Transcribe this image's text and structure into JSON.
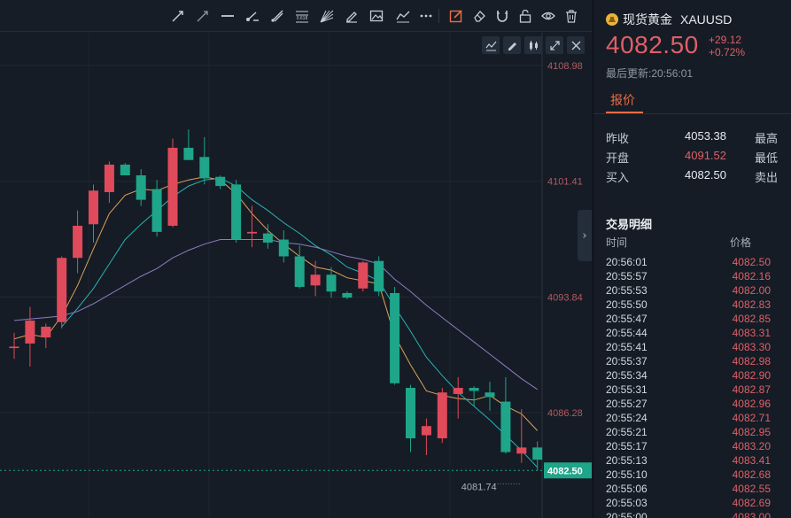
{
  "toolbar": {
    "tools": [
      "trend-line-icon",
      "ray-icon",
      "horizontal-line-icon",
      "info-line-icon",
      "parallel-channel-icon",
      "fib-retracement-icon",
      "fib-fan-icon",
      "brush-icon",
      "picture-icon",
      "path-icon",
      "more-icon",
      "edit-icon",
      "eraser-icon",
      "magnet-icon",
      "lock-icon",
      "eye-icon",
      "trash-icon"
    ],
    "fib_tool_text": "0.618",
    "active_color": "#ea6d47"
  },
  "chart_tools": [
    "indicator-icon",
    "draw-icon",
    "candle-type-icon",
    "fullscreen-icon",
    "close-icon"
  ],
  "chart_data": {
    "type": "candlestick",
    "symbol": "XAUUSD",
    "price_axis": {
      "ticks": [
        "4108.98",
        "4101.41",
        "4093.84",
        "4086.28"
      ],
      "tick_values": [
        4108.98,
        4101.41,
        4093.84,
        4086.28
      ],
      "range": [
        4079.0,
        4110.0
      ]
    },
    "last_price_label": "4082.50",
    "last_price": 4082.5,
    "low_label": "4081.74",
    "low_value": 4081.74,
    "up_color": "#e04a5a",
    "down_color": "#1fa589",
    "candles": [
      {
        "o": 4090.5,
        "h": 4091.5,
        "l": 4089.8,
        "c": 4090.6
      },
      {
        "o": 4090.8,
        "h": 4093.2,
        "l": 4089.3,
        "c": 4092.3
      },
      {
        "o": 4091.2,
        "h": 4092.1,
        "l": 4090.5,
        "c": 4091.9
      },
      {
        "o": 4092.2,
        "h": 4096.5,
        "l": 4091.8,
        "c": 4096.4
      },
      {
        "o": 4096.4,
        "h": 4099.5,
        "l": 4095.4,
        "c": 4098.5
      },
      {
        "o": 4098.6,
        "h": 4101.2,
        "l": 4097.4,
        "c": 4100.8
      },
      {
        "o": 4100.7,
        "h": 4102.7,
        "l": 4100.0,
        "c": 4102.5
      },
      {
        "o": 4102.5,
        "h": 4102.6,
        "l": 4101.8,
        "c": 4101.8
      },
      {
        "o": 4101.8,
        "h": 4102.2,
        "l": 4099.8,
        "c": 4100.2
      },
      {
        "o": 4100.9,
        "h": 4101.5,
        "l": 4097.8,
        "c": 4098.1
      },
      {
        "o": 4098.5,
        "h": 4104.2,
        "l": 4098.4,
        "c": 4103.6
      },
      {
        "o": 4103.6,
        "h": 4104.8,
        "l": 4102.8,
        "c": 4102.8
      },
      {
        "o": 4103.0,
        "h": 4104.3,
        "l": 4101.2,
        "c": 4101.6
      },
      {
        "o": 4101.7,
        "h": 4101.8,
        "l": 4100.9,
        "c": 4101.1
      },
      {
        "o": 4101.2,
        "h": 4101.5,
        "l": 4097.4,
        "c": 4097.6
      },
      {
        "o": 4098.0,
        "h": 4099.8,
        "l": 4097.1,
        "c": 4098.1
      },
      {
        "o": 4098.0,
        "h": 4098.6,
        "l": 4097.0,
        "c": 4097.4
      },
      {
        "o": 4097.6,
        "h": 4098.2,
        "l": 4096.1,
        "c": 4096.5
      },
      {
        "o": 4096.5,
        "h": 4097.2,
        "l": 4094.4,
        "c": 4094.5
      },
      {
        "o": 4094.6,
        "h": 4096.2,
        "l": 4093.9,
        "c": 4095.3
      },
      {
        "o": 4095.3,
        "h": 4095.8,
        "l": 4093.8,
        "c": 4094.2
      },
      {
        "o": 4094.1,
        "h": 4094.2,
        "l": 4093.7,
        "c": 4093.8
      },
      {
        "o": 4094.4,
        "h": 4096.2,
        "l": 4094.2,
        "c": 4096.1
      },
      {
        "o": 4096.2,
        "h": 4096.5,
        "l": 4093.9,
        "c": 4094.2
      },
      {
        "o": 4094.1,
        "h": 4094.5,
        "l": 4088.1,
        "c": 4088.2
      },
      {
        "o": 4087.9,
        "h": 4088.1,
        "l": 4083.7,
        "c": 4084.6
      },
      {
        "o": 4084.8,
        "h": 4085.9,
        "l": 4083.5,
        "c": 4085.4
      },
      {
        "o": 4084.6,
        "h": 4087.9,
        "l": 4084.3,
        "c": 4087.6
      },
      {
        "o": 4087.5,
        "h": 4088.6,
        "l": 4085.9,
        "c": 4087.9
      },
      {
        "o": 4087.9,
        "h": 4088.0,
        "l": 4086.7,
        "c": 4087.7
      },
      {
        "o": 4087.6,
        "h": 4088.3,
        "l": 4086.4,
        "c": 4087.3
      },
      {
        "o": 4087.0,
        "h": 4088.6,
        "l": 4083.6,
        "c": 4083.7
      },
      {
        "o": 4083.6,
        "h": 4086.5,
        "l": 4083.0,
        "c": 4084.0
      },
      {
        "o": 4084.0,
        "h": 4084.4,
        "l": 4082.5,
        "c": 4083.2
      }
    ],
    "ma_lines": [
      {
        "color": "#e0a156",
        "values": [
          4091.1,
          4091.4,
          4091.2,
          4092.6,
          4094.6,
          4097.0,
          4099.3,
          4100.5,
          4100.9,
          4100.8,
          4101.2,
          4101.5,
          4101.7,
          4101.5,
          4100.6,
          4099.3,
          4098.2,
          4097.3,
          4096.5,
          4095.8,
          4095.6,
          4095.1,
          4094.9,
          4094.7,
          4091.3,
          4089.4,
          4087.7,
          4087.4,
          4087.2,
          4087.1,
          4087.4,
          4086.7,
          4086.2,
          4085.1
        ]
      },
      {
        "color": "#29b3b4",
        "values": [
          null,
          null,
          null,
          4091.9,
          4093.1,
          4094.4,
          4096.0,
          4097.6,
          4098.6,
          4099.5,
          4100.4,
          4101.1,
          4101.5,
          4101.6,
          4101.1,
          4100.2,
          4099.5,
          4098.7,
          4098.0,
          4097.2,
          4096.6,
          4095.8,
          4095.4,
          4094.9,
          4093.2,
          4091.6,
          4089.9,
          4088.7,
          4087.6,
          4086.7,
          4085.8,
          4084.8,
          4083.8,
          4082.7
        ]
      },
      {
        "color": "#8e7bc5",
        "values": [
          4092.3,
          4092.4,
          4092.5,
          4092.6,
          4092.9,
          4093.4,
          4094.0,
          4094.6,
          4095.2,
          4095.7,
          4096.4,
          4096.9,
          4097.3,
          4097.6,
          4097.6,
          4097.6,
          4097.6,
          4097.4,
          4097.3,
          4097.1,
          4096.8,
          4096.5,
          4096.3,
          4096.0,
          4095.0,
          4094.2,
          4093.3,
          4092.5,
          4091.7,
          4090.9,
          4090.1,
          4089.3,
          4088.5,
          4087.8
        ]
      }
    ]
  },
  "panel": {
    "name": "现货黄金",
    "code": "XAUUSD",
    "price": "4082.50",
    "change": "+29.12",
    "change_pct": "+0.72%",
    "updated": "最后更新:20:56:01",
    "tab": "报价",
    "quotes": [
      {
        "label": "昨收",
        "value": "4053.38",
        "value_color": "#e8ecf1",
        "label2": "最高"
      },
      {
        "label": "开盘",
        "value": "4091.52",
        "value_color": "#e05f68",
        "label2": "最低"
      },
      {
        "label": "买入",
        "value": "4082.50",
        "value_color": "#e8ecf1",
        "label2": "卖出"
      }
    ],
    "trades_title": "交易明细",
    "col_time": "时间",
    "col_price": "价格",
    "trades": [
      {
        "time": "20:56:01",
        "price": "4082.50"
      },
      {
        "time": "20:55:57",
        "price": "4082.16"
      },
      {
        "time": "20:55:53",
        "price": "4082.00"
      },
      {
        "time": "20:55:50",
        "price": "4082.83"
      },
      {
        "time": "20:55:47",
        "price": "4082.85"
      },
      {
        "time": "20:55:44",
        "price": "4083.31"
      },
      {
        "time": "20:55:41",
        "price": "4083.30"
      },
      {
        "time": "20:55:37",
        "price": "4082.98"
      },
      {
        "time": "20:55:34",
        "price": "4082.90"
      },
      {
        "time": "20:55:31",
        "price": "4082.87"
      },
      {
        "time": "20:55:27",
        "price": "4082.96"
      },
      {
        "time": "20:55:24",
        "price": "4082.71"
      },
      {
        "time": "20:55:21",
        "price": "4082.95"
      },
      {
        "time": "20:55:17",
        "price": "4083.20"
      },
      {
        "time": "20:55:13",
        "price": "4083.41"
      },
      {
        "time": "20:55:10",
        "price": "4082.68"
      },
      {
        "time": "20:55:06",
        "price": "4082.55"
      },
      {
        "time": "20:55:03",
        "price": "4082.69"
      },
      {
        "time": "20:55:00",
        "price": "4083.00"
      }
    ]
  }
}
